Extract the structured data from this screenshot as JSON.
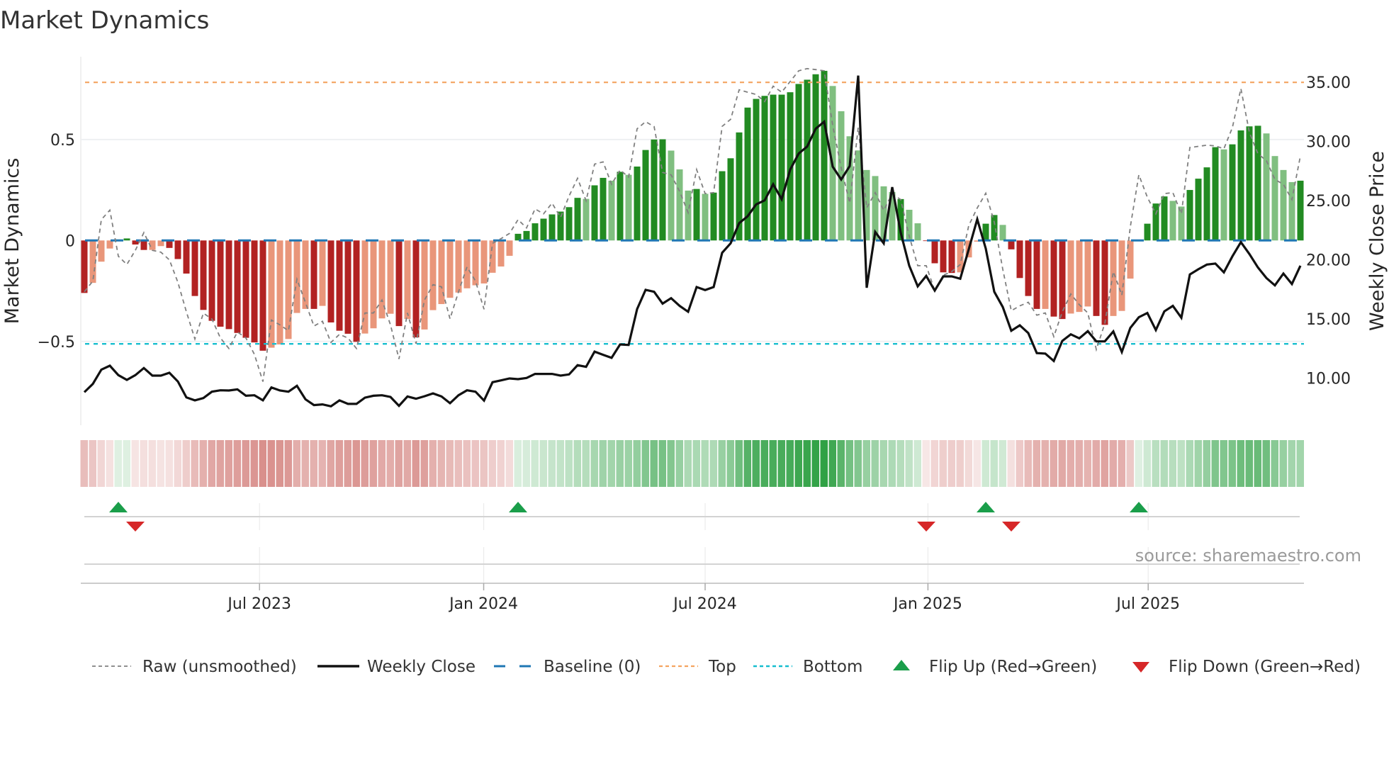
{
  "chart_data": {
    "type": "bar",
    "title": "Market Dynamics",
    "ylabel": "Market Dynamics",
    "ylabel_right": "Weekly Close Price",
    "ylim": [
      -0.915,
      0.91
    ],
    "ylim_right": [
      6.02,
      37.14
    ],
    "yticks": [
      {
        "value": 0.5,
        "label": "0.5"
      },
      {
        "value": 0,
        "label": "0"
      },
      {
        "value": -0.5,
        "label": "−0.5"
      }
    ],
    "yticks_right": [
      {
        "value": 35,
        "label": "35.00"
      },
      {
        "value": 30,
        "label": "30.00"
      },
      {
        "value": 25,
        "label": "25.00"
      },
      {
        "value": 20,
        "label": "20.00"
      },
      {
        "value": 15,
        "label": "15.00"
      },
      {
        "value": 10,
        "label": "10.00"
      }
    ],
    "x_unit": "week index",
    "xticks": [
      {
        "value": 20.6,
        "label": "Jul 2023"
      },
      {
        "value": 46.96,
        "label": "Jan 2024"
      },
      {
        "value": 73.0,
        "label": "Jul 2024"
      },
      {
        "value": 99.2,
        "label": "Jan 2025"
      },
      {
        "value": 125.1,
        "label": "Jul 2025"
      }
    ],
    "thresholds": {
      "baseline": 0,
      "top": 0.783,
      "bottom": -0.512
    },
    "series": [
      {
        "name": "Market Dynamics (smoothed)",
        "kind": "bar",
        "values": [
          -0.26,
          -0.21,
          -0.105,
          -0.04,
          0.005,
          0.01,
          -0.02,
          -0.047,
          -0.047,
          -0.028,
          -0.037,
          -0.092,
          -0.164,
          -0.275,
          -0.344,
          -0.398,
          -0.427,
          -0.439,
          -0.458,
          -0.482,
          -0.505,
          -0.546,
          -0.531,
          -0.515,
          -0.488,
          -0.359,
          -0.339,
          -0.339,
          -0.324,
          -0.406,
          -0.447,
          -0.462,
          -0.502,
          -0.461,
          -0.435,
          -0.386,
          -0.363,
          -0.424,
          -0.389,
          -0.48,
          -0.441,
          -0.345,
          -0.315,
          -0.284,
          -0.258,
          -0.237,
          -0.222,
          -0.213,
          -0.16,
          -0.129,
          -0.076,
          0.033,
          0.047,
          0.085,
          0.108,
          0.129,
          0.143,
          0.165,
          0.211,
          0.206,
          0.273,
          0.31,
          0.296,
          0.34,
          0.325,
          0.366,
          0.448,
          0.5,
          0.501,
          0.445,
          0.352,
          0.247,
          0.255,
          0.231,
          0.237,
          0.343,
          0.407,
          0.535,
          0.658,
          0.701,
          0.716,
          0.722,
          0.722,
          0.734,
          0.775,
          0.796,
          0.823,
          0.84,
          0.765,
          0.64,
          0.516,
          0.446,
          0.349,
          0.319,
          0.268,
          0.24,
          0.205,
          0.152,
          0.085,
          -0.003,
          -0.113,
          -0.158,
          -0.161,
          -0.158,
          -0.084,
          -0.006,
          0.083,
          0.126,
          0.077,
          -0.044,
          -0.186,
          -0.275,
          -0.339,
          -0.339,
          -0.377,
          -0.389,
          -0.362,
          -0.354,
          -0.327,
          -0.374,
          -0.418,
          -0.374,
          -0.349,
          -0.189,
          0.003,
          0.083,
          0.183,
          0.218,
          0.196,
          0.168,
          0.25,
          0.306,
          0.362,
          0.462,
          0.451,
          0.476,
          0.545,
          0.565,
          0.568,
          0.53,
          0.418,
          0.349,
          0.289,
          0.296
        ],
        "strong": [
          1,
          0,
          0,
          0,
          1,
          1,
          1,
          1,
          0,
          0,
          1,
          1,
          1,
          1,
          1,
          1,
          1,
          1,
          1,
          1,
          1,
          1,
          0,
          0,
          0,
          0,
          0,
          1,
          0,
          1,
          1,
          1,
          1,
          0,
          0,
          0,
          0,
          1,
          0,
          1,
          0,
          0,
          0,
          0,
          0,
          0,
          0,
          0,
          0,
          0,
          0,
          1,
          1,
          1,
          1,
          1,
          1,
          1,
          1,
          0,
          1,
          1,
          0,
          1,
          0,
          1,
          1,
          1,
          1,
          0,
          0,
          0,
          1,
          0,
          1,
          1,
          1,
          1,
          1,
          1,
          1,
          1,
          1,
          1,
          1,
          1,
          1,
          1,
          0,
          0,
          0,
          0,
          0,
          0,
          0,
          0,
          1,
          0,
          0,
          1,
          1,
          1,
          1,
          0,
          0,
          0,
          1,
          1,
          0,
          1,
          1,
          1,
          1,
          0,
          1,
          1,
          0,
          0,
          0,
          1,
          1,
          0,
          0,
          0,
          1,
          1,
          1,
          1,
          0,
          0,
          1,
          1,
          1,
          1,
          0,
          1,
          1,
          1,
          1,
          0,
          0,
          0,
          0,
          1
        ]
      },
      {
        "name": "Raw (unsmoothed)",
        "kind": "line",
        "values": [
          -0.254,
          -0.201,
          0.103,
          0.15,
          -0.078,
          -0.119,
          -0.049,
          0.039,
          -0.049,
          -0.058,
          -0.096,
          -0.207,
          -0.353,
          -0.488,
          -0.36,
          -0.389,
          -0.483,
          -0.535,
          -0.453,
          -0.483,
          -0.564,
          -0.699,
          -0.394,
          -0.418,
          -0.447,
          -0.192,
          -0.307,
          -0.424,
          -0.4,
          -0.505,
          -0.465,
          -0.483,
          -0.535,
          -0.359,
          -0.359,
          -0.295,
          -0.418,
          -0.587,
          -0.359,
          -0.511,
          -0.295,
          -0.219,
          -0.23,
          -0.388,
          -0.254,
          -0.131,
          -0.201,
          -0.341,
          -0.014,
          0.009,
          0.035,
          0.103,
          0.062,
          0.156,
          0.132,
          0.185,
          0.114,
          0.22,
          0.308,
          0.197,
          0.378,
          0.389,
          0.278,
          0.349,
          0.314,
          0.553,
          0.588,
          0.564,
          0.337,
          0.325,
          0.243,
          0.138,
          0.351,
          0.232,
          0.237,
          0.565,
          0.6,
          0.746,
          0.734,
          0.723,
          0.688,
          0.764,
          0.734,
          0.787,
          0.84,
          0.851,
          0.846,
          0.84,
          0.57,
          0.36,
          0.185,
          0.559,
          0.161,
          0.237,
          0.149,
          0.232,
          0.202,
          0.021,
          -0.125,
          -0.125,
          -0.248,
          -0.172,
          -0.154,
          -0.119,
          0.074,
          0.161,
          0.234,
          0.091,
          -0.143,
          -0.348,
          -0.324,
          -0.306,
          -0.37,
          -0.359,
          -0.476,
          -0.353,
          -0.265,
          -0.318,
          -0.359,
          -0.54,
          -0.411,
          -0.154,
          -0.271,
          0.068,
          0.325,
          0.214,
          0.132,
          0.232,
          0.237,
          0.132,
          0.46,
          0.466,
          0.472,
          0.468,
          0.454,
          0.559,
          0.752,
          0.535,
          0.43,
          0.395,
          0.302,
          0.278,
          0.202,
          0.419
        ]
      },
      {
        "name": "Weekly Close",
        "kind": "line",
        "axis": "right",
        "values": [
          8.81,
          9.51,
          10.71,
          11.05,
          10.25,
          9.85,
          10.25,
          10.85,
          10.21,
          10.21,
          10.45,
          9.71,
          8.37,
          8.12,
          8.31,
          8.85,
          8.97,
          8.95,
          9.05,
          8.51,
          8.55,
          8.12,
          9.21,
          8.95,
          8.85,
          9.35,
          8.21,
          7.72,
          7.78,
          7.62,
          8.12,
          7.82,
          7.82,
          8.35,
          8.51,
          8.55,
          8.41,
          7.66,
          8.45,
          8.26,
          8.47,
          8.71,
          8.45,
          7.88,
          8.55,
          8.97,
          8.85,
          8.1,
          9.65,
          9.81,
          9.97,
          9.91,
          10.01,
          10.35,
          10.35,
          10.35,
          10.21,
          10.31,
          11.09,
          10.95,
          12.24,
          11.97,
          11.71,
          12.84,
          12.8,
          15.83,
          17.45,
          17.29,
          16.29,
          16.75,
          16.1,
          15.6,
          17.69,
          17.43,
          17.69,
          20.58,
          21.38,
          23.08,
          23.67,
          24.67,
          25.01,
          26.37,
          25.11,
          27.6,
          28.96,
          29.56,
          31.06,
          31.65,
          27.86,
          26.77,
          27.9,
          35.54,
          17.63,
          22.34,
          21.38,
          26.13,
          22.28,
          19.49,
          17.75,
          18.63,
          17.39,
          18.59,
          18.59,
          18.39,
          20.88,
          23.42,
          20.94,
          17.29,
          16.0,
          14.0,
          14.46,
          13.8,
          12.11,
          12.07,
          11.45,
          13.14,
          13.7,
          13.36,
          13.96,
          13.1,
          13.1,
          13.94,
          12.2,
          14.24,
          15.14,
          15.5,
          14.06,
          15.64,
          16.1,
          15.1,
          18.75,
          19.19,
          19.59,
          19.67,
          18.93,
          20.28,
          21.48,
          20.48,
          19.35,
          18.45,
          17.83,
          18.83,
          17.95,
          19.49
        ]
      }
    ],
    "flips": {
      "up": [
        4,
        51,
        106,
        124
      ],
      "down": [
        6,
        99,
        109
      ]
    },
    "legend": {
      "placement": "bottom",
      "items": [
        {
          "label": "Raw (unsmoothed)",
          "style": "raw"
        },
        {
          "label": "Weekly Close",
          "style": "close"
        },
        {
          "label": "Baseline (0)",
          "style": "baseline"
        },
        {
          "label": "Top",
          "style": "top"
        },
        {
          "label": "Bottom",
          "style": "bottom"
        },
        {
          "label": "Flip Up (Red→Green)",
          "style": "flipup"
        },
        {
          "label": "Flip Down (Green→Red)",
          "style": "flipdown"
        }
      ]
    },
    "colors": {
      "pos_strong": "#228b22",
      "pos_weak": "#80bf80",
      "neg_strong": "#b22222",
      "neg_weak": "#e9967a",
      "close": "#111111",
      "raw": "#808080",
      "baseline": "#1f77b4",
      "top": "#f4a460",
      "bottom": "#17becf",
      "flip_up": "#1a9e4a",
      "flip_down": "#d62728"
    }
  },
  "source": "source: sharemaestro.com"
}
